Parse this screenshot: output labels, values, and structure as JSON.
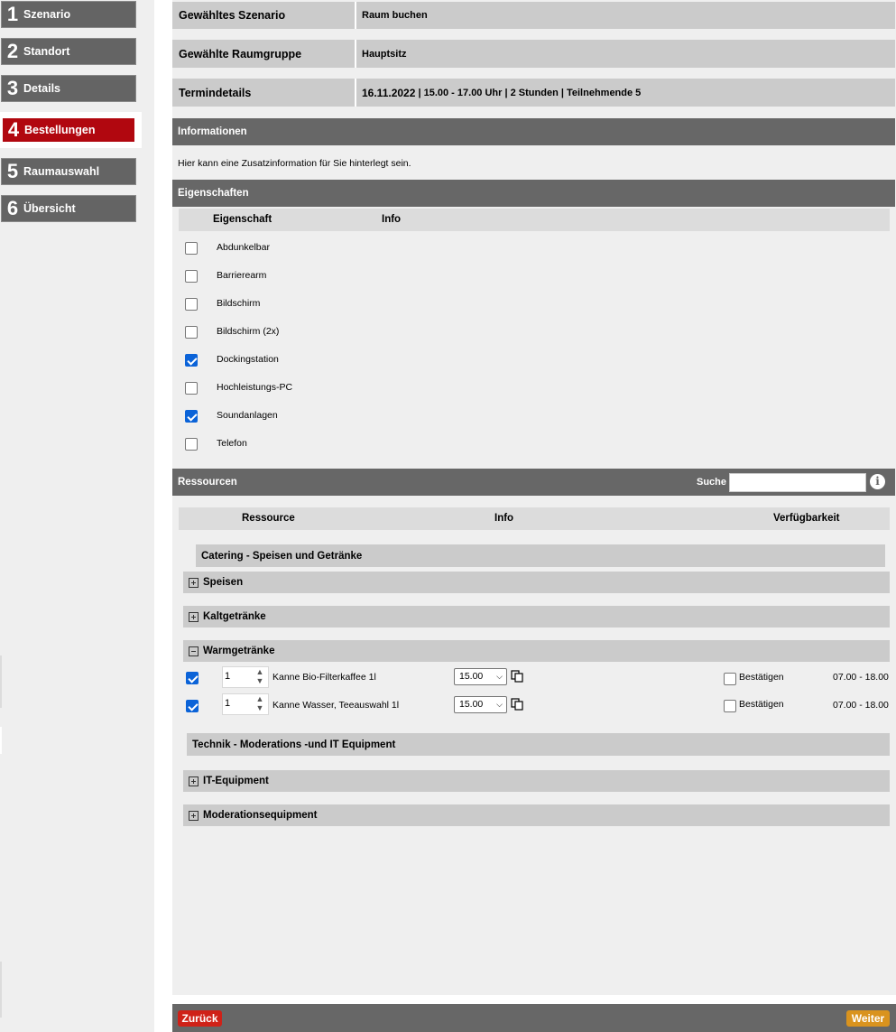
{
  "steps": [
    {
      "num": "1",
      "label": "Szenario"
    },
    {
      "num": "2",
      "label": "Standort"
    },
    {
      "num": "3",
      "label": "Details"
    },
    {
      "num": "4",
      "label": "Bestellungen"
    },
    {
      "num": "5",
      "label": "Raumauswahl"
    },
    {
      "num": "6",
      "label": "Übersicht"
    }
  ],
  "summary": {
    "scenario_key": "Gewähltes Szenario",
    "scenario_value": "Raum buchen",
    "roomgroup_key": "Gewählte Raumgruppe",
    "roomgroup_value": "Hauptsitz",
    "details_key": "Termindetails",
    "details_date": "16.11.2022",
    "details_rest": " | 15.00 - 17.00 Uhr | 2 Stunden | Teilnehmende 5"
  },
  "informationen": {
    "title": "Informationen",
    "text": "Hier kann eine Zusatzinformation für Sie hinterlegt sein."
  },
  "eigenschaften": {
    "title": "Eigenschaften",
    "col_property": "Eigenschaft",
    "col_info": "Info",
    "items": [
      {
        "label": "Abdunkelbar",
        "checked": false
      },
      {
        "label": "Barrierearm",
        "checked": false
      },
      {
        "label": "Bildschirm",
        "checked": false
      },
      {
        "label": "Bildschirm (2x)",
        "checked": false
      },
      {
        "label": "Dockingstation",
        "checked": true
      },
      {
        "label": "Hochleistungs-PC",
        "checked": false
      },
      {
        "label": "Soundanlagen",
        "checked": true
      },
      {
        "label": "Telefon",
        "checked": false
      }
    ]
  },
  "ressourcen": {
    "title": "Ressourcen",
    "search_label": "Suche",
    "search_value": "",
    "col_resource": "Ressource",
    "col_info": "Info",
    "col_availability": "Verfügbarkeit",
    "category_catering": "Catering - Speisen und Getränke",
    "group_speisen": "Speisen",
    "group_kalt": "Kaltgetränke",
    "group_warm": "Warmgetränke",
    "items": [
      {
        "checked": true,
        "qty": "1",
        "label": "Kanne Bio-Filterkaffee 1l",
        "time": "15.00",
        "confirm": "Bestätigen",
        "availability": "07.00 - 18.00"
      },
      {
        "checked": true,
        "qty": "1",
        "label": "Kanne Wasser, Teeauswahl 1l",
        "time": "15.00",
        "confirm": "Bestätigen",
        "availability": "07.00 - 18.00"
      }
    ],
    "category_technik": "Technik - Moderations -und IT Equipment",
    "group_it": "IT-Equipment",
    "group_moderation": "Moderationsequipment"
  },
  "footer": {
    "back_label": "Zurück",
    "next_label": "Weiter"
  },
  "colors": {
    "active_step": "#b1070f",
    "step": "#646464",
    "header": "#676767",
    "checkbox": "#0b63d8",
    "back_button": "#cf2118",
    "next_button": "#d9931e"
  }
}
